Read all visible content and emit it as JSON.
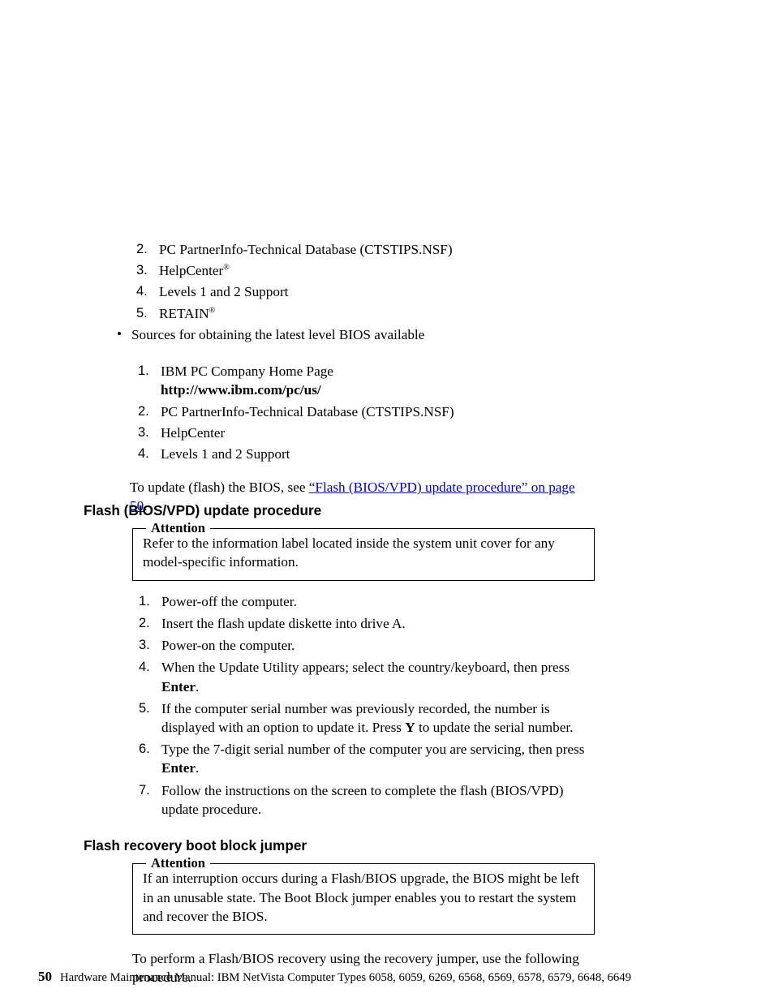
{
  "listA": {
    "i2": "PC PartnerInfo-Technical Database (CTSTIPS.NSF)",
    "i3": "HelpCenter",
    "i4": "Levels 1 and 2 Support",
    "i5": " RETAIN"
  },
  "bullet": "Sources for obtaining the latest level BIOS available",
  "listB": {
    "ibm1": "IBM PC Company Home Page",
    "ibm2": "http://www.ibm.com/pc/us/",
    "i2": "PC PartnerInfo-Technical Database (CTSTIPS.NSF)",
    "i3": "HelpCenter",
    "i4": "Levels 1 and 2 Support"
  },
  "flash_intro": {
    "pre": "To update (flash) the BIOS, see ",
    "link": "“Flash (BIOS/VPD) update procedure” on page 50",
    "post": "."
  },
  "h1": "Flash (BIOS/VPD) update procedure",
  "att1": {
    "legend": "Attention",
    "body": "Refer to the information label located inside the system unit cover for any model-specific information."
  },
  "steps": {
    "s1": "Power-off the computer.",
    "s2": "Insert the flash update diskette into drive A.",
    "s3": "Power-on the computer.",
    "s4a": "When the Update Utility appears; select the country/keyboard, then press ",
    "s4b": "Enter",
    "s4c": ".",
    "s5a": "If the computer serial number was previously recorded, the number is displayed with an option to update it. Press ",
    "s5b": "Y",
    "s5c": " to update the serial number.",
    "s6a": "Type the 7-digit serial number of the computer you are servicing, then press ",
    "s6b": "Enter",
    "s6c": ".",
    "s7": "Follow the instructions on the screen to complete the flash (BIOS/VPD) update procedure."
  },
  "h2": "Flash recovery boot block jumper",
  "att2": {
    "legend": "Attention",
    "body": "If an interruption occurs during a Flash/BIOS upgrade, the BIOS might be left in an unusable state. The Boot Block jumper enables you to restart the system and recover the BIOS."
  },
  "after_att2": "To perform a Flash/BIOS recovery using the recovery jumper, use the following procedure.",
  "footer": {
    "page": "50",
    "text": "Hardware Maintenance Manual: IBM NetVista Computer Types 6058, 6059, 6269, 6568, 6569, 6578, 6579, 6648, 6649"
  },
  "reg": "®"
}
